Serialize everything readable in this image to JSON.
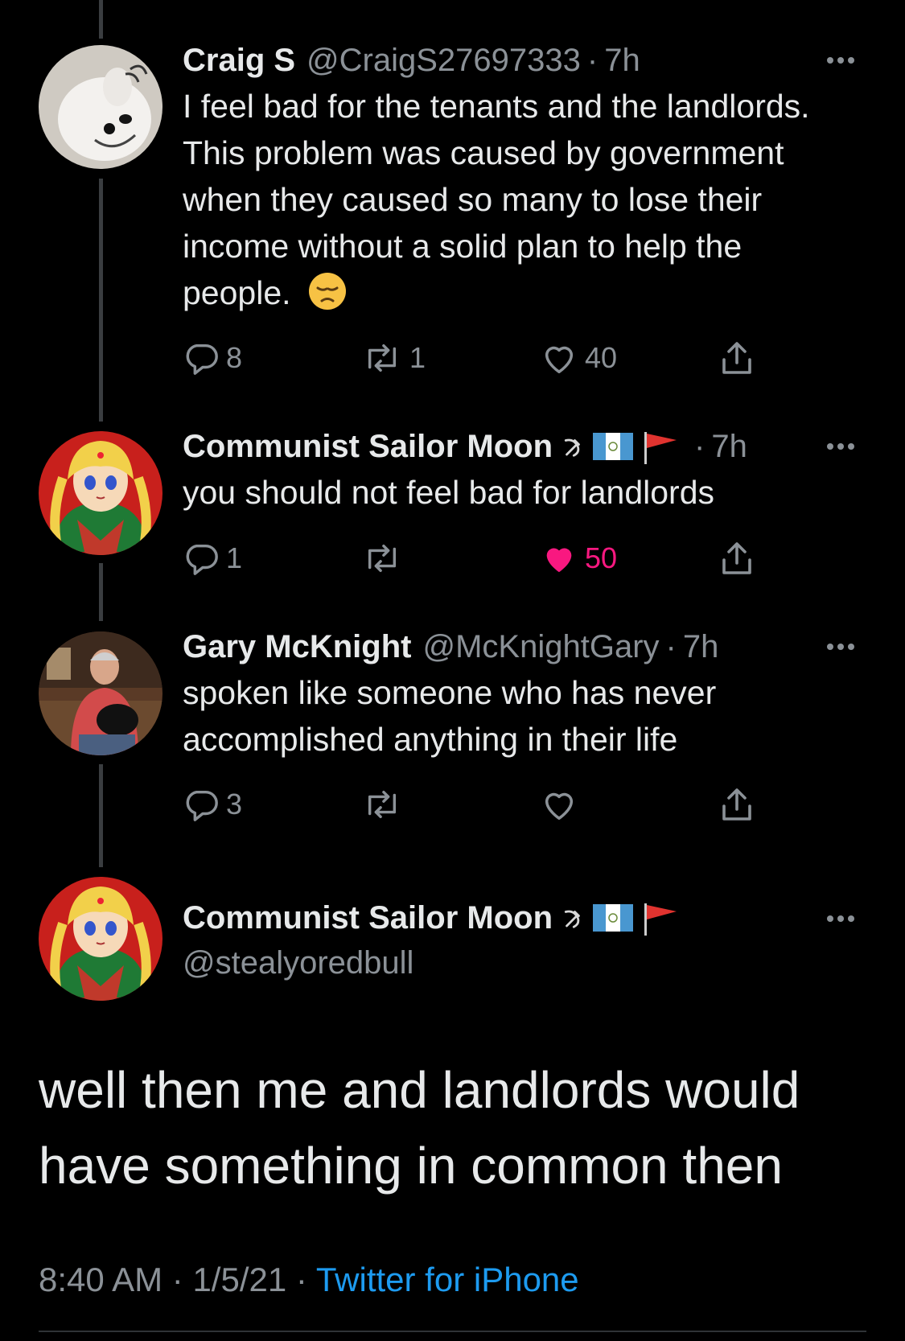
{
  "colors": {
    "background": "#000000",
    "text_primary": "#e7e9ea",
    "text_secondary": "#8b9197",
    "like_active": "#f91880",
    "link": "#1d9bf0"
  },
  "thread": [
    {
      "display_name": "Craig S",
      "handle": "@CraigS27697333",
      "separator": "·",
      "time": "7h",
      "text": "I feel bad for the tenants and the landlords. This problem was caused by government when they caused so many to lose their income without a solid plan to help the people.",
      "emoji": "😔",
      "avatar_icon": "dog-avatar-icon",
      "actions": {
        "replies": "8",
        "retweets": "1",
        "likes": "40",
        "liked": false
      }
    },
    {
      "display_name": "Communist Sailor Moon",
      "handle": "",
      "separator": "·",
      "time": "7h",
      "text": "you should not feel bad for landlords",
      "badges": [
        "hammer-sickle-icon",
        "guatemala-flag-icon",
        "red-flag-icon"
      ],
      "avatar_icon": "sailor-moon-avatar-icon",
      "actions": {
        "replies": "1",
        "retweets": "",
        "likes": "50",
        "liked": true
      }
    },
    {
      "display_name": "Gary McKnight",
      "handle": "@McKnightGary",
      "separator": "·",
      "time": "7h",
      "text": "spoken like someone who has never accomplished anything in their life",
      "avatar_icon": "man-photo-avatar-icon",
      "actions": {
        "replies": "3",
        "retweets": "",
        "likes": "",
        "liked": false
      }
    }
  ],
  "main_tweet": {
    "display_name": "Communist Sailor Moon",
    "handle": "@stealyoredbull",
    "badges": [
      "hammer-sickle-icon",
      "guatemala-flag-icon",
      "red-flag-icon"
    ],
    "avatar_icon": "sailor-moon-avatar-icon",
    "text": "well then me and landlords would have something in common then",
    "time": "8:40 AM",
    "separator": "·",
    "date": "1/5/21",
    "source": "Twitter for iPhone"
  }
}
